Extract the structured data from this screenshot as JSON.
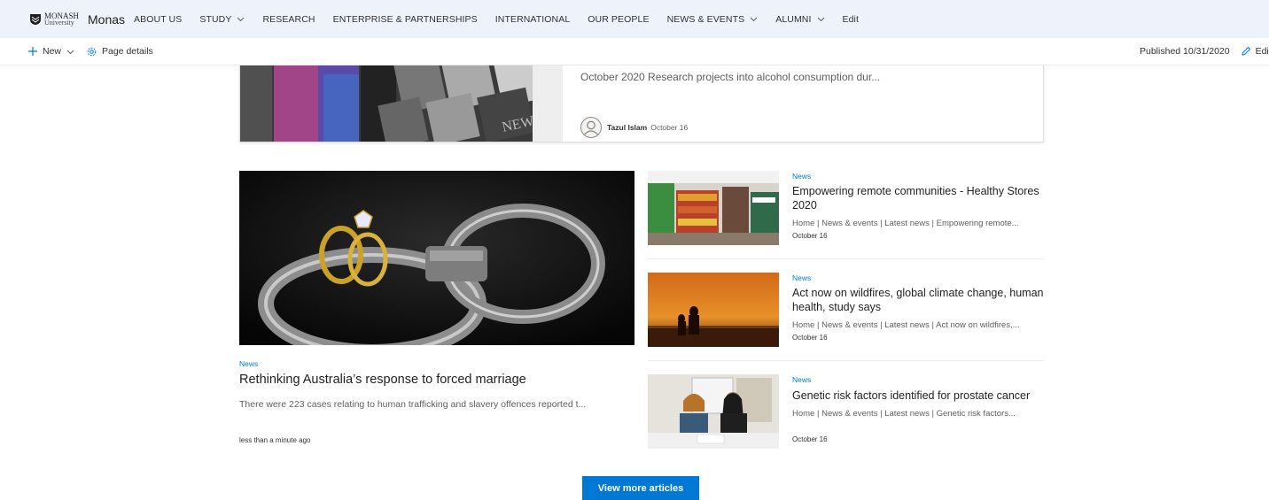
{
  "header": {
    "logo_line1": "MONASH",
    "logo_line2": "University",
    "site_name": "Monas",
    "nav": [
      {
        "label": "ABOUT US",
        "dropdown": false
      },
      {
        "label": "STUDY",
        "dropdown": true
      },
      {
        "label": "RESEARCH",
        "dropdown": false
      },
      {
        "label": "ENTERPRISE & PARTNERSHIPS",
        "dropdown": false
      },
      {
        "label": "INTERNATIONAL",
        "dropdown": false
      },
      {
        "label": "OUR PEOPLE",
        "dropdown": false
      },
      {
        "label": "NEWS & EVENTS",
        "dropdown": true
      },
      {
        "label": "ALUMNI",
        "dropdown": true
      },
      {
        "label": "Edit",
        "dropdown": false
      }
    ]
  },
  "command_bar": {
    "new_label": "New",
    "page_details_label": "Page details",
    "published_label": "Published 10/31/2020",
    "edit_label": "Edi"
  },
  "top_card": {
    "snippet": "October 2020 Research projects into alcohol consumption dur...",
    "author": "Tazul Islam",
    "date": "October 16"
  },
  "main_article": {
    "tag": "News",
    "title": "Rethinking Australia’s response to forced marriage",
    "description": "There were 223 cases relating to human trafficking and slavery offences reported t...",
    "time": "less than a minute ago"
  },
  "side_articles": [
    {
      "tag": "News",
      "title": "Empowering remote communities - Healthy Stores 2020",
      "breadcrumb": "Home | News & events | Latest news | Empowering remote...",
      "date": "October 16"
    },
    {
      "tag": "News",
      "title": "Act now on wildfires, global climate change, human health, study says",
      "breadcrumb": "Home | News & events | Latest news | Act now on wildfires,...",
      "date": "October 16"
    },
    {
      "tag": "News",
      "title": "Genetic risk factors identified for prostate cancer",
      "breadcrumb": "Home | News & events | Latest news | Genetic risk factors...",
      "date": "October 16"
    }
  ],
  "view_more_label": "View more articles",
  "colors": {
    "accent": "#0078d4",
    "nav_bg": "#eef3fb"
  },
  "icons": {
    "new": "plus-icon",
    "page_details": "gear-icon",
    "edit": "pencil-icon",
    "dropdown": "chevron-down-icon"
  }
}
